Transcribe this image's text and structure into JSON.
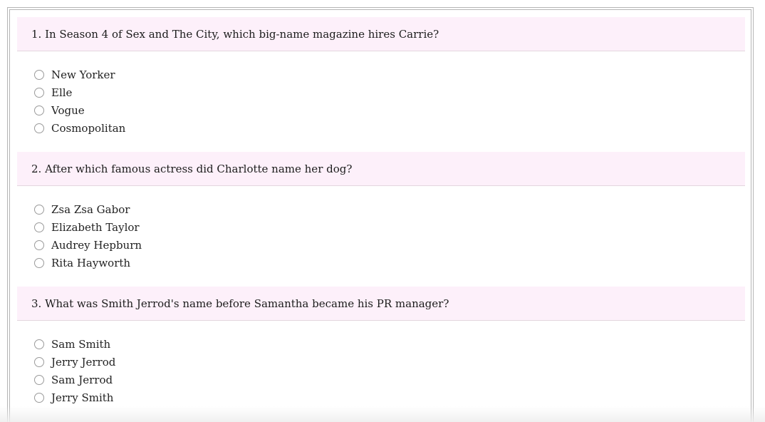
{
  "quiz": {
    "questions": [
      {
        "text": "1. In Season 4 of Sex and The City, which big-name magazine hires Carrie?",
        "options": [
          "New Yorker",
          "Elle",
          "Vogue",
          "Cosmopolitan"
        ]
      },
      {
        "text": "2. After which famous actress did Charlotte name her dog?",
        "options": [
          "Zsa Zsa Gabor",
          "Elizabeth Taylor",
          "Audrey Hepburn",
          "Rita Hayworth"
        ]
      },
      {
        "text": "3. What was Smith Jerrod's name before Samantha became his PR manager?",
        "options": [
          "Sam Smith",
          "Jerry Jerrod",
          "Sam Jerrod",
          "Jerry Smith"
        ]
      }
    ]
  },
  "colors": {
    "question_header_bg": "#fdf0fa",
    "divider": "#e3d6de",
    "frame_border": "#b5b5b5",
    "radio_border": "#9a9a9a",
    "text": "#222222"
  },
  "icons": {
    "radio": "radio-button-unselected-icon"
  }
}
